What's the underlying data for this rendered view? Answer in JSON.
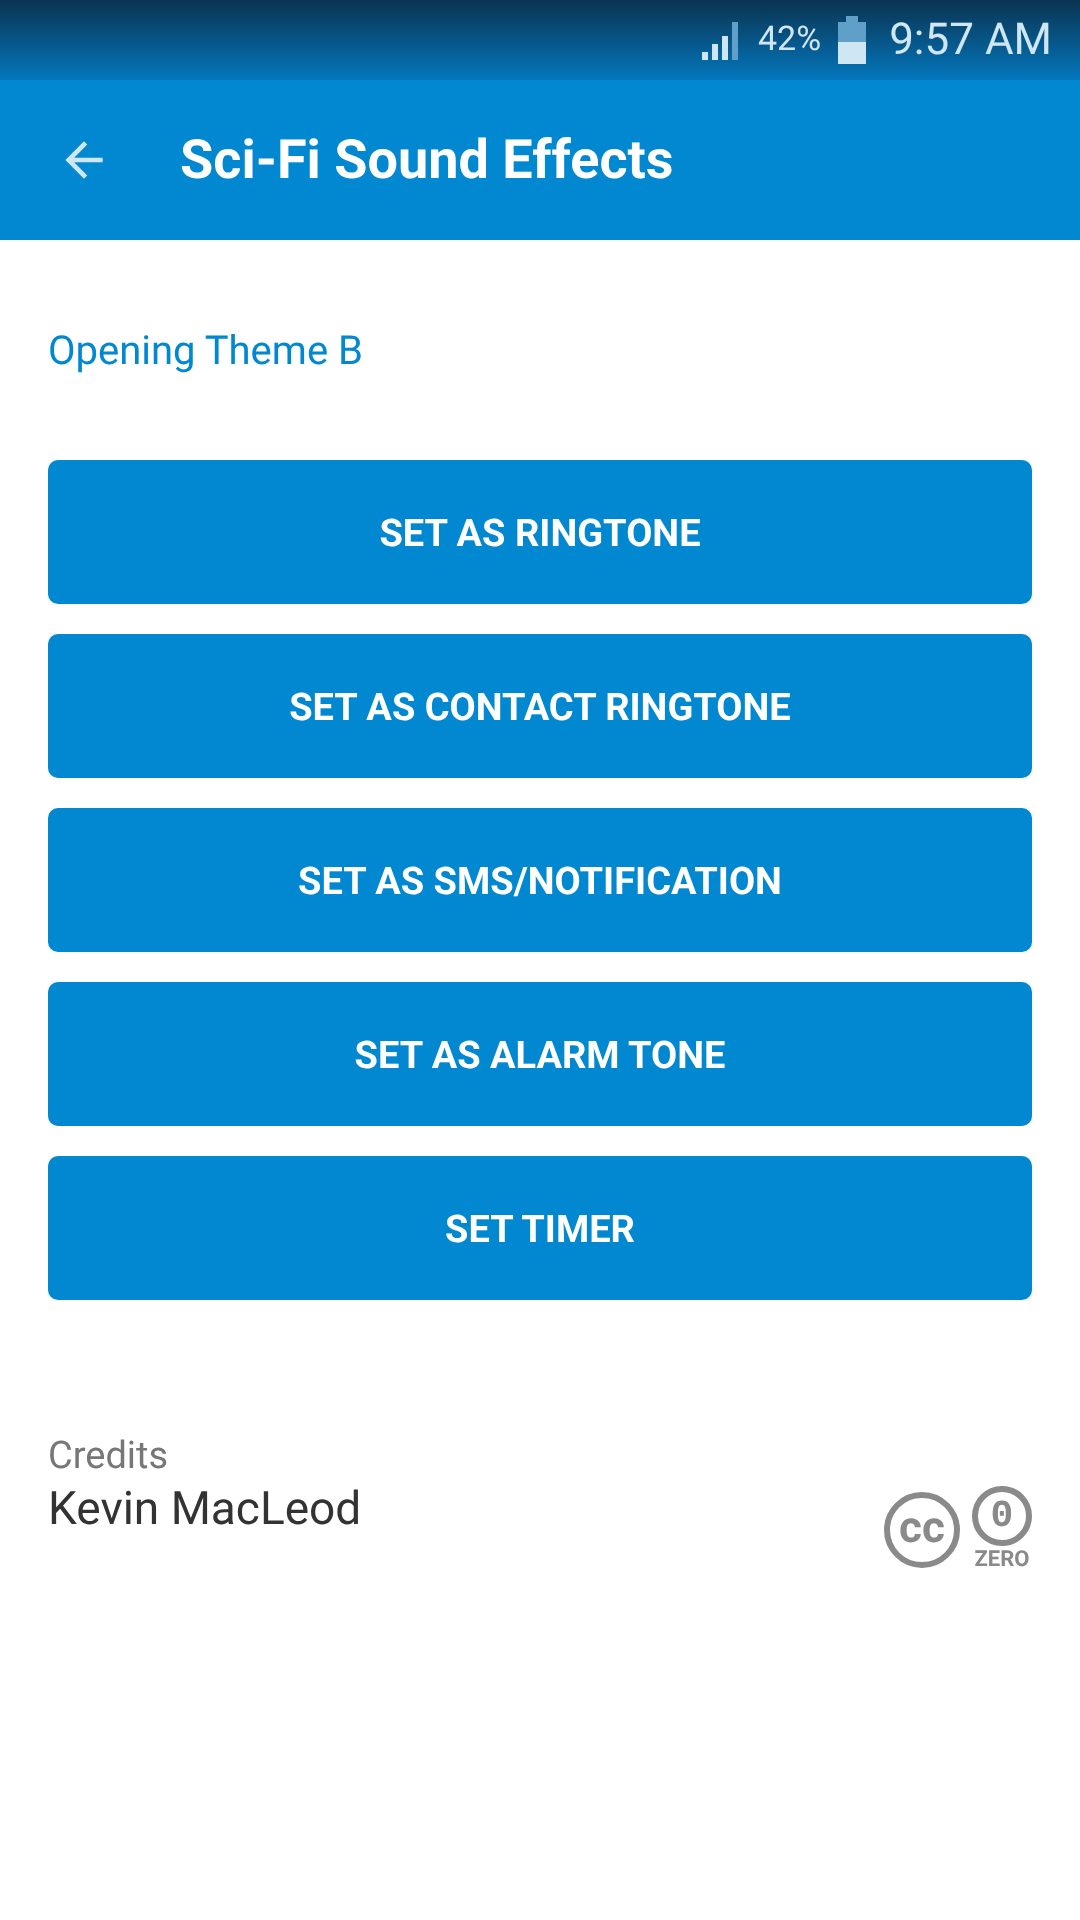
{
  "status_bar": {
    "battery": "42%",
    "time": "9:57 AM"
  },
  "app_bar": {
    "title": "Sci-Fi Sound Effects"
  },
  "sound_title": "Opening Theme B",
  "buttons": [
    "SET AS RINGTONE",
    "SET AS CONTACT RINGTONE",
    "SET AS SMS/NOTIFICATION",
    "SET AS ALARM TONE",
    "SET TIMER"
  ],
  "credits": {
    "label": "Credits",
    "author": "Kevin MacLeod",
    "license": {
      "cc": "cc",
      "zero_mark": "0",
      "zero": "ZERO"
    }
  }
}
